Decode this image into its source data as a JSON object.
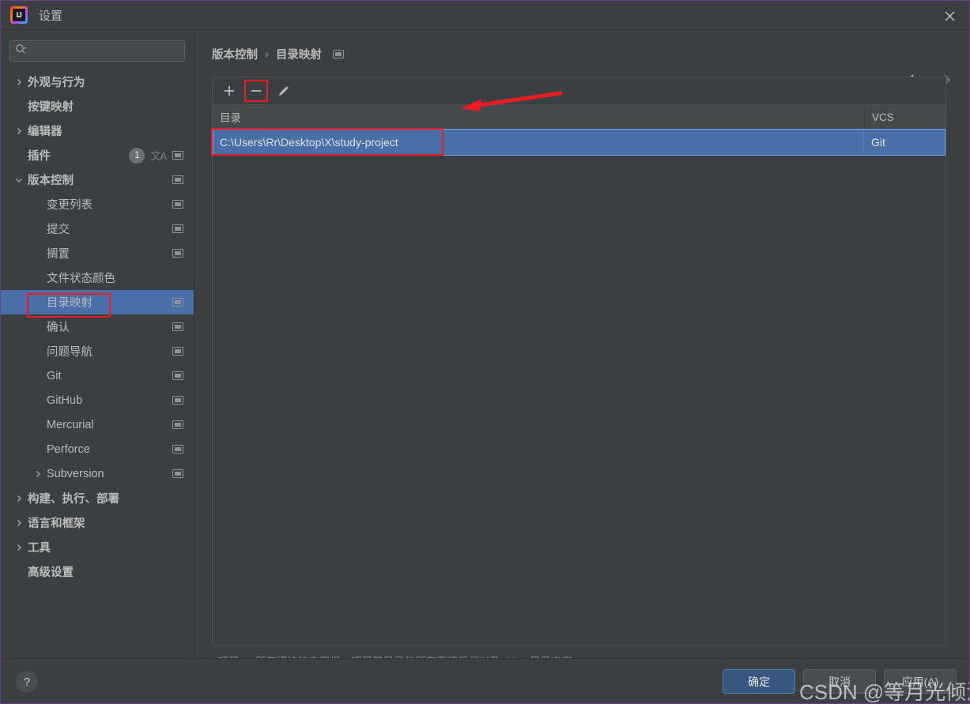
{
  "window": {
    "title": "设置",
    "app_icon": "intellij-idea-icon",
    "close_label": "×"
  },
  "search": {
    "placeholder": "",
    "value": "",
    "icon": "search-icon"
  },
  "sidebar": {
    "items": [
      {
        "label": "外观与行为",
        "indent": 0,
        "chevron": "right",
        "bold": true,
        "badge": null,
        "translate": false,
        "monitor": false,
        "selected": false
      },
      {
        "label": "按键映射",
        "indent": 0,
        "chevron": "none",
        "bold": true,
        "badge": null,
        "translate": false,
        "monitor": false,
        "selected": false
      },
      {
        "label": "编辑器",
        "indent": 0,
        "chevron": "right",
        "bold": true,
        "badge": null,
        "translate": false,
        "monitor": false,
        "selected": false
      },
      {
        "label": "插件",
        "indent": 0,
        "chevron": "none",
        "bold": true,
        "badge": "1",
        "translate": true,
        "monitor": true,
        "selected": false
      },
      {
        "label": "版本控制",
        "indent": 0,
        "chevron": "down",
        "bold": true,
        "badge": null,
        "translate": false,
        "monitor": true,
        "selected": false
      },
      {
        "label": "变更列表",
        "indent": 1,
        "chevron": "none",
        "bold": false,
        "badge": null,
        "translate": false,
        "monitor": true,
        "selected": false
      },
      {
        "label": "提交",
        "indent": 1,
        "chevron": "none",
        "bold": false,
        "badge": null,
        "translate": false,
        "monitor": true,
        "selected": false
      },
      {
        "label": "搁置",
        "indent": 1,
        "chevron": "none",
        "bold": false,
        "badge": null,
        "translate": false,
        "monitor": true,
        "selected": false
      },
      {
        "label": "文件状态颜色",
        "indent": 1,
        "chevron": "none",
        "bold": false,
        "badge": null,
        "translate": false,
        "monitor": false,
        "selected": false
      },
      {
        "label": "目录映射",
        "indent": 1,
        "chevron": "none",
        "bold": false,
        "badge": null,
        "translate": false,
        "monitor": true,
        "selected": true
      },
      {
        "label": "确认",
        "indent": 1,
        "chevron": "none",
        "bold": false,
        "badge": null,
        "translate": false,
        "monitor": true,
        "selected": false
      },
      {
        "label": "问题导航",
        "indent": 1,
        "chevron": "none",
        "bold": false,
        "badge": null,
        "translate": false,
        "monitor": true,
        "selected": false
      },
      {
        "label": "Git",
        "indent": 1,
        "chevron": "none",
        "bold": false,
        "badge": null,
        "translate": false,
        "monitor": true,
        "selected": false
      },
      {
        "label": "GitHub",
        "indent": 1,
        "chevron": "none",
        "bold": false,
        "badge": null,
        "translate": false,
        "monitor": true,
        "selected": false
      },
      {
        "label": "Mercurial",
        "indent": 1,
        "chevron": "none",
        "bold": false,
        "badge": null,
        "translate": false,
        "monitor": true,
        "selected": false
      },
      {
        "label": "Perforce",
        "indent": 1,
        "chevron": "none",
        "bold": false,
        "badge": null,
        "translate": false,
        "monitor": true,
        "selected": false
      },
      {
        "label": "Subversion",
        "indent": 1,
        "chevron": "right",
        "bold": false,
        "badge": null,
        "translate": false,
        "monitor": true,
        "selected": false
      },
      {
        "label": "构建、执行、部署",
        "indent": 0,
        "chevron": "right",
        "bold": true,
        "badge": null,
        "translate": false,
        "monitor": false,
        "selected": false
      },
      {
        "label": "语言和框架",
        "indent": 0,
        "chevron": "right",
        "bold": true,
        "badge": null,
        "translate": false,
        "monitor": false,
        "selected": false
      },
      {
        "label": "工具",
        "indent": 0,
        "chevron": "right",
        "bold": true,
        "badge": null,
        "translate": false,
        "monitor": false,
        "selected": false
      },
      {
        "label": "高级设置",
        "indent": 0,
        "chevron": "none",
        "bold": true,
        "badge": null,
        "translate": false,
        "monitor": false,
        "selected": false
      }
    ]
  },
  "main": {
    "breadcrumb": {
      "root": "版本控制",
      "separator": "›",
      "current": "目录映射",
      "monitor_icon": "monitor-icon"
    },
    "nav": {
      "back_icon": "arrow-left-icon",
      "forward_icon": "arrow-right-icon"
    },
    "toolbar": {
      "add_label": "+",
      "remove_label": "−",
      "edit_icon": "pencil-icon"
    },
    "table": {
      "columns": [
        "目录",
        "VCS"
      ],
      "rows": [
        {
          "directory": "C:\\Users\\Rr\\Desktop\\X\\study-project",
          "vcs": "Git",
          "selected": true
        }
      ]
    },
    "hint": "<项目> - 所有模块的内容根、项目基目录的所有直接后代以及 .idea 目录内容"
  },
  "footer": {
    "help_label": "?",
    "buttons": [
      {
        "label": "确定",
        "primary": true
      },
      {
        "label": "取消",
        "primary": false
      },
      {
        "label": "应用(A)",
        "primary": false
      }
    ]
  },
  "annotations": {
    "watermark": "CSDN @等月光倾洒",
    "highlight_color": "#ec1c24"
  }
}
